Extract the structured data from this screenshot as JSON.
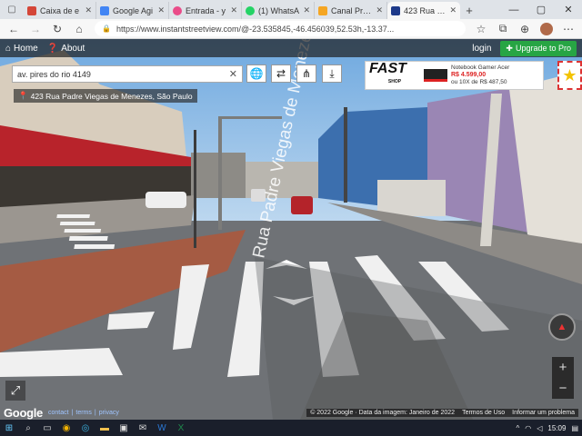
{
  "browser": {
    "tabs": [
      {
        "title": "Caixa de e",
        "color": "#d44638"
      },
      {
        "title": "Google Agi",
        "color": "#4285f4"
      },
      {
        "title": "Entrada - y",
        "color": "#ea4c89"
      },
      {
        "title": "(1) WhatsA",
        "color": "#25d366"
      },
      {
        "title": "Canal Pro -",
        "color": "#f5a623"
      },
      {
        "title": "423 Rua Pa",
        "color": "#1e3a8a"
      }
    ],
    "url": "https://www.instantstreetview.com/@-23.535845,-46.456039,52.53h,-13.37..."
  },
  "app": {
    "home": "Home",
    "about": "About",
    "login": "login",
    "upgrade": "Upgrade to Pro",
    "search_value": "av. pires do rio 4149",
    "location": "423 Rua Padre Viegas de Menezes, São Paulo"
  },
  "ad": {
    "brand": "FAST",
    "brand_sub": "SHOP",
    "product": "Notebook Gamer Acer",
    "price": "R$ 4.599,00",
    "installments": "ou 10X de R$ 487,50"
  },
  "footer": {
    "google": "Google",
    "links": [
      "contact",
      "terms",
      "privacy"
    ],
    "copyright": "© 2022 Google · Data da imagem: Janeiro de 2022",
    "terms": "Termos de Uso",
    "report": "Informar um problema"
  },
  "scene": {
    "street_label": "Rua Padre Viegas de Menezes"
  },
  "taskbar": {
    "time": "15:09"
  }
}
